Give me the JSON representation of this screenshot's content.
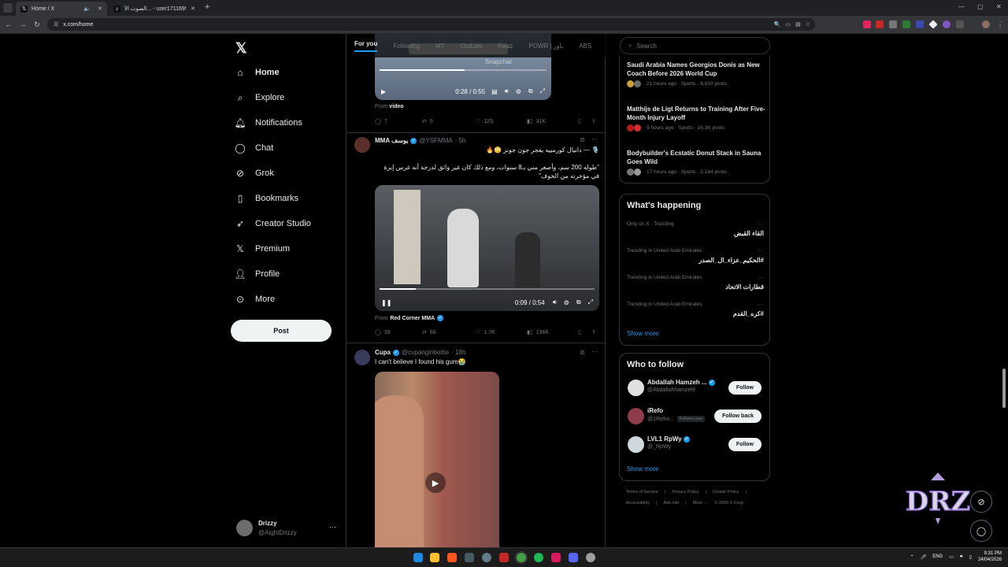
{
  "browser": {
    "tabs": [
      {
        "title": "Home / X",
        "icon": "x-logo-icon",
        "active": true
      },
      {
        "title": "الصوت الأ... - user171169950​84",
        "icon": "tiktok-icon",
        "active": false
      }
    ],
    "url": "x.com/home"
  },
  "nav": {
    "items": [
      {
        "label": "Home",
        "icon": "home-icon"
      },
      {
        "label": "Explore",
        "icon": "search-icon"
      },
      {
        "label": "Notifications",
        "icon": "bell-icon"
      },
      {
        "label": "Chat",
        "icon": "chat-bubble-icon"
      },
      {
        "label": "Grok",
        "icon": "grok-icon"
      },
      {
        "label": "Bookmarks",
        "icon": "bookmark-icon"
      },
      {
        "label": "Creator Studio",
        "icon": "rocket-icon"
      },
      {
        "label": "Premium",
        "icon": "x-logo-icon"
      },
      {
        "label": "Profile",
        "icon": "person-icon"
      },
      {
        "label": "More",
        "icon": "more-circle-icon"
      }
    ],
    "post_label": "Post",
    "account": {
      "name": "Drizzy",
      "handle": "@AightDrizzy",
      "more": "···"
    }
  },
  "feed": {
    "tabs": [
      "For you",
      "Following",
      "MT",
      "OutLaw",
      "Fwaz",
      "POWR | باور",
      "ABS"
    ],
    "tweet0": {
      "video_time": "0:28 / 0:55",
      "watermark": "Snapchat",
      "from_label": "From",
      "from_source": "video",
      "replies": "7",
      "reposts": "5",
      "likes": "125",
      "views": "31K"
    },
    "tweet1": {
      "name": "MMA يوسف",
      "handle": "@YSFMMA",
      "time": "· 5h",
      "line1": "🎙️ — دانيال كورمييه يفجر جون جونز 😳🔥",
      "line2": "\"طوله 200 سم، وأصغر مني بـ8 سنوات، ومع ذلك كان غير واثق لدرجة أنه غرس إبرة في مؤخرته من الخوف\"",
      "video_time": "0:09 / 0:54",
      "from_label": "From",
      "from_source": "Red Corner MMA",
      "replies": "39",
      "reposts": "68",
      "likes": "1.7K",
      "views": "136K"
    },
    "tweet2": {
      "name": "Cupa",
      "handle": "@cupanginbottle",
      "time": "· 18h",
      "text": "I can't believe I found his gum😭"
    }
  },
  "right": {
    "search_placeholder": "Search",
    "news": [
      {
        "title": "Saudi Arabia Names Georgios Donis as New Coach Before 2026 World Cup",
        "meta": "21 hours ago · Sports · 8,810 posts"
      },
      {
        "title": "Matthijs de Ligt Returns to Training After Five-Month Injury Layoff",
        "meta": "9 hours ago · Sports · 16.3K posts"
      },
      {
        "title": "Bodybuilder's Ecstatic Donut Stack in Sauna Goes Wild",
        "meta": "17 hours ago · Sports · 2,144 posts"
      }
    ],
    "happening_title": "What's happening",
    "trends": [
      {
        "context": "Only on X · Trending",
        "name": "القاء القبض"
      },
      {
        "context": "Trending in United Arab Emirates",
        "name": "#الحكيم_عزاء_ال_الصدر"
      },
      {
        "context": "Trending in United Arab Emirates",
        "name": "قطارات الاتحاد"
      },
      {
        "context": "Trending in United Arab Emirates",
        "name": "#كره_القدم"
      }
    ],
    "show_more": "Show more",
    "wtf_title": "Who to follow",
    "follow": [
      {
        "name": "Abdallah Hamzeh ...",
        "handle": "@Abdallahhamzehl",
        "button": "Follow",
        "follows_you": ""
      },
      {
        "name": "iRefo",
        "handle": "@1Refor...",
        "button": "Follow back",
        "follows_you": "Follows you"
      },
      {
        "name": "LVL1 RpWy",
        "handle": "@_RpWy",
        "button": "Follow",
        "follows_you": ""
      }
    ],
    "footer": {
      "row1": [
        "Terms of Service",
        "|",
        "Privacy Policy",
        "|",
        "Cookie Policy",
        "|"
      ],
      "row2": [
        "Accessibility",
        "|",
        "Ads info",
        "|",
        "More ···",
        "© 2026 X Corp."
      ]
    }
  },
  "overlay": {
    "logo_text": "DRZ"
  },
  "taskbar": {
    "lang": "ENG",
    "time": "9:31 PM",
    "date": "24/04/2026"
  }
}
